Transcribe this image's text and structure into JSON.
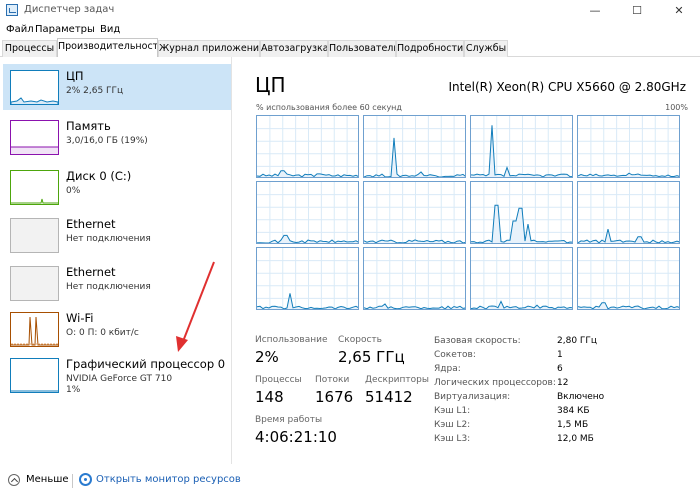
{
  "window": {
    "title": "Диспетчер задач",
    "minimize": "—",
    "maximize": "☐",
    "close": "✕"
  },
  "menu": [
    "Файл",
    "Параметры",
    "Вид"
  ],
  "tabs": [
    "Процессы",
    "Производительность",
    "Журнал приложений",
    "Автозагрузка",
    "Пользователи",
    "Подробности",
    "Службы"
  ],
  "active_tab": 1,
  "sidebar": [
    {
      "title": "ЦП",
      "sub": "2% 2,65 ГГц",
      "color": "#117dbb",
      "selected": true
    },
    {
      "title": "Память",
      "sub": "3,0/16,0 ГБ (19%)",
      "color": "#8b12ae",
      "fill": 0.19
    },
    {
      "title": "Диск 0 (C:)",
      "sub": "0%",
      "color": "#4da60c"
    },
    {
      "title": "Ethernet",
      "sub": "Нет подключения",
      "color": "#9a9a9a"
    },
    {
      "title": "Ethernet",
      "sub": "Нет подключения",
      "color": "#9a9a9a"
    },
    {
      "title": "Wi-Fi",
      "sub": "О: 0 П: 0 кбит/с",
      "color": "#a74f01"
    },
    {
      "title": "Графический процессор 0",
      "sub": "NVIDIA GeForce GT 710",
      "sub2": "1%",
      "color": "#117dbb"
    }
  ],
  "main": {
    "title": "ЦП",
    "cpu_name": "Intel(R) Xeon(R) CPU X5660 @ 2.80GHz",
    "graph_caption": "% использования более 60 секунд",
    "graph_max": "100%",
    "stats": {
      "usage_label": "Использование",
      "usage_value": "2%",
      "speed_label": "Скорость",
      "speed_value": "2,65 ГГц",
      "processes_label": "Процессы",
      "processes_value": "148",
      "threads_label": "Потоки",
      "threads_value": "1676",
      "handles_label": "Дескрипторы",
      "handles_value": "51412",
      "uptime_label": "Время работы",
      "uptime_value": "4:06:21:10"
    },
    "info": [
      {
        "label": "Базовая скорость:",
        "value": "2,80 ГГц"
      },
      {
        "label": "Сокетов:",
        "value": "1"
      },
      {
        "label": "Ядра:",
        "value": "6"
      },
      {
        "label": "Логических процессоров:",
        "value": "12"
      },
      {
        "label": "Виртуализация:",
        "value": "Включено"
      },
      {
        "label": "Кэш L1:",
        "value": "384 КБ"
      },
      {
        "label": "Кэш L2:",
        "value": "1,5 МБ"
      },
      {
        "label": "Кэш L3:",
        "value": "12,0 МБ"
      }
    ]
  },
  "footer": {
    "fewer": "Меньше",
    "monitor": "Открыть монитор ресурсов"
  },
  "colors": {
    "graph_line": "#117dbb",
    "graph_border": "#6fa0cf",
    "grid_line": "#d9eaf7",
    "arrow": "#e03030"
  }
}
